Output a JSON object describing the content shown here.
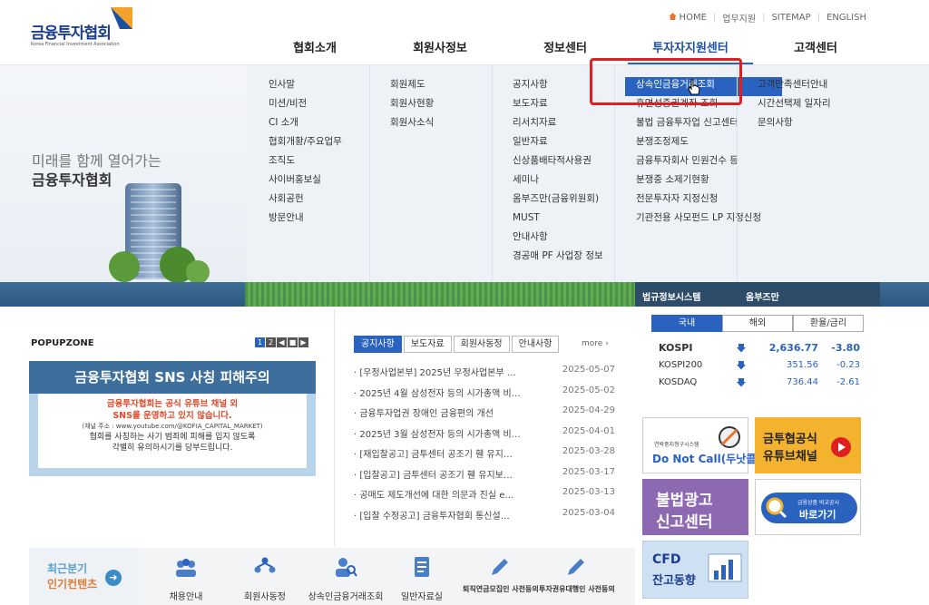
{
  "header": {
    "logo_text": "금융투자협회",
    "logo_sub": "Korea Financial Investment Association",
    "util": [
      "HOME",
      "업무지원",
      "SITEMAP",
      "ENGLISH"
    ],
    "gnb": [
      "협회소개",
      "회원사정보",
      "정보센터",
      "투자자지원센터",
      "고객센터"
    ],
    "active_gnb": "투자자지원센터"
  },
  "hero": {
    "line1": "미래를 함께 열어가는",
    "line2": "금융투자협회"
  },
  "mega": {
    "col1": [
      "인사말",
      "미션/비전",
      "CI 소개",
      "협회개황/주요업무",
      "조직도",
      "사이버홍보실",
      "사회공헌",
      "방문안내"
    ],
    "col2": [
      "회원제도",
      "회원사현황",
      "회원사소식"
    ],
    "col3": [
      "공지사항",
      "보도자료",
      "리서치자료",
      "일반자료",
      "신상품배타적사용권",
      "세미나",
      "옴부즈만(금융위원회)",
      "MUST",
      "안내사항",
      "경공매 PF 사업장 정보"
    ],
    "col4": [
      "상속인금융거래조회",
      "휴면성증권계좌 조회",
      "불법 금융투자업 신고센터",
      "분쟁조정제도",
      "금융투자회사 민원건수 등",
      "분쟁중 소제기현황",
      "전문투자자 지정신청",
      "기관전용 사모펀드 LP 지정신청"
    ],
    "col5": [
      "고객만족센터안내",
      "시간선택제 일자리",
      "문의사항"
    ]
  },
  "strip": {
    "left": "법규정보시스템",
    "right": "옴부즈만"
  },
  "popupzone": {
    "title": "POPUPZONE",
    "pages": [
      "1",
      "2",
      "◀",
      "■",
      "▶"
    ],
    "banner_title": "금융투자협회 SNS 사칭 피해주의",
    "red1": "금융투자협회는 공식 유튜브 채널 외",
    "red2": "SNS를 운영하고 있지 않습니다.",
    "note": "(채널 주소 : www.youtube.com/@KOFIA_CAPITAL_MARKET)",
    "warn1": "협회를 사칭하는 사기 범죄에 피해를 입지 않도록",
    "warn2": "각별히 유의하시기를 당부드립니다."
  },
  "notice": {
    "tabs": [
      "공지사항",
      "보도자료",
      "회원사동정",
      "안내사항"
    ],
    "more": "more",
    "items": [
      {
        "title": "· [우정사업본부] 2025년 우정사업본부 …",
        "date": "2025-05-07"
      },
      {
        "title": "· 2025년 4월 삼성전자 등의 시가총액 비…",
        "date": "2025-05-02"
      },
      {
        "title": "· 금융투자업권 장애인 금융편의 개선",
        "date": "2025-04-29"
      },
      {
        "title": "· 2025년 3월 삼성전자 등의 시가총액 비…",
        "date": "2025-04-01"
      },
      {
        "title": "· [재입찰공고] 금투센터 공조기 휀 유지…",
        "date": "2025-03-28"
      },
      {
        "title": "· [입찰공고] 금투센터 공조기 휀 유지보…",
        "date": "2025-03-17"
      },
      {
        "title": "· 공매도 제도개선에 대한 의문과 진실 e…",
        "date": "2025-03-13"
      },
      {
        "title": "· [입찰 수정공고] 금융투자협회 통신설…",
        "date": "2025-03-04"
      }
    ]
  },
  "market": {
    "tabs": [
      "국내",
      "해외",
      "환율/금리"
    ],
    "rows": [
      {
        "name": "KOSPI",
        "value": "2,636.77",
        "change": "-3.80"
      },
      {
        "name": "KOSPI200",
        "value": "351.56",
        "change": "-0.23"
      },
      {
        "name": "KOSDAQ",
        "value": "736.44",
        "change": "-2.61"
      }
    ]
  },
  "banners": {
    "dnc_small": "연락중지청구시스템",
    "dnc": "Do Not Call(두낫콜)",
    "youtube1": "금투협공식",
    "youtube2": "유튜브채널",
    "illegal1": "불법광고",
    "illegal2": "신고센터",
    "compare_small": "금융상품 비교공시",
    "compare": "바로가기",
    "cfd1": "CFD",
    "cfd2": "잔고동향"
  },
  "quick": {
    "lead1": "최근분기",
    "lead2": "인기컨텐츠",
    "items": [
      "채용안내",
      "회원사동정",
      "상속인금융거래조회",
      "일반자료실",
      "퇴직연금모집인 사전등의",
      "투자권유대행인 사전등의"
    ]
  },
  "colors": {
    "brand_blue": "#2a62c0",
    "highlight_red": "#e02020",
    "navy": "#1b3f8f"
  }
}
